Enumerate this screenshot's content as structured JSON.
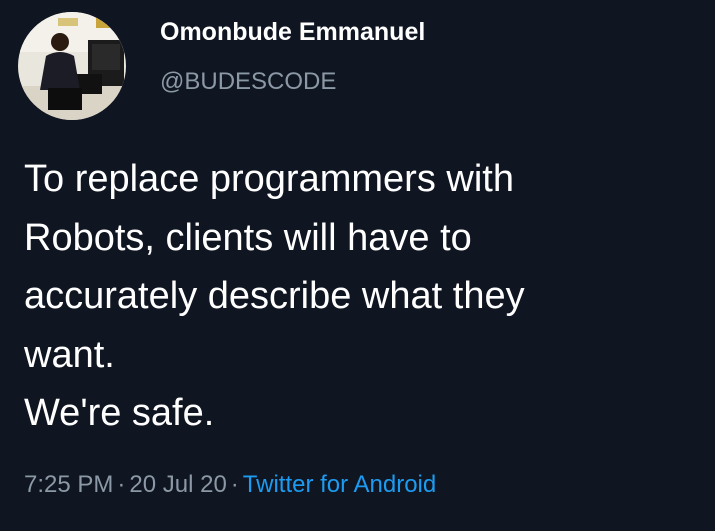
{
  "tweet": {
    "author": {
      "display_name": "Omonbude Emmanuel",
      "handle": "@BUDESCODE"
    },
    "text_lines": [
      "To replace programmers with",
      "Robots, clients will have to",
      "accurately describe what they",
      "want.",
      "We're safe."
    ],
    "meta": {
      "time": "7:25 PM",
      "separator": "·",
      "date": "20 Jul 20",
      "source": "Twitter for Android"
    }
  },
  "colors": {
    "background": "#0f1521",
    "text": "#ffffff",
    "secondary_text": "#8b98a5",
    "link": "#1d9bf0"
  }
}
